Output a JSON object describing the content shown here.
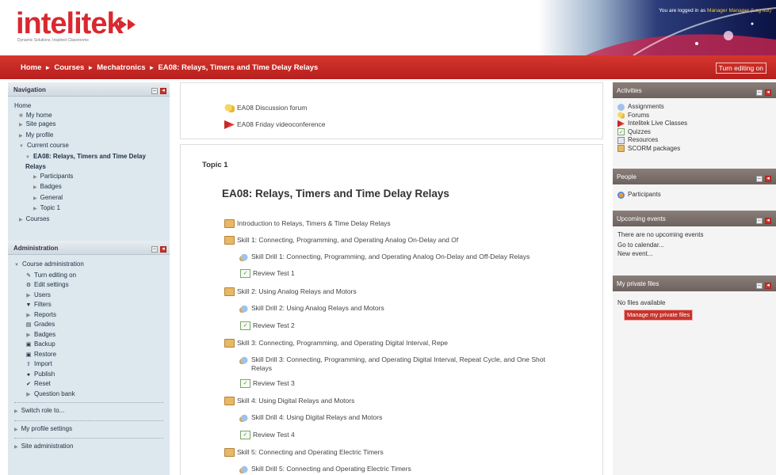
{
  "header": {
    "logo_text": "intelitek",
    "logo_tagline": "Dynamic Solutions, Inspired Classrooms",
    "login_prefix": "You are logged in as",
    "login_user": "Manager Manager",
    "logout": "(Log out)"
  },
  "breadcrumb": {
    "items": [
      "Home",
      "Courses",
      "Mechatronics",
      "EA08: Relays, Timers and Time Delay Relays"
    ],
    "separator": "►",
    "edit_button": "Turn editing on"
  },
  "navigation": {
    "title": "Navigation",
    "home": "Home",
    "my_home": "My home",
    "site_pages": "Site pages",
    "my_profile": "My profile",
    "current_course": "Current course",
    "course": "EA08: Relays, Timers and Time Delay Relays",
    "participants": "Participants",
    "badges": "Badges",
    "general": "General",
    "topic1": "Topic 1",
    "courses": "Courses"
  },
  "administration": {
    "title": "Administration",
    "course_admin": "Course administration",
    "items": [
      "Turn editing on",
      "Edit settings",
      "Users",
      "Filters",
      "Reports",
      "Grades",
      "Badges",
      "Backup",
      "Restore",
      "Import",
      "Publish",
      "Reset",
      "Question bank"
    ],
    "switch_role": "Switch role to...",
    "profile_settings": "My profile settings",
    "site_admin": "Site administration"
  },
  "section0": {
    "forum": "EA08 Discussion forum",
    "video": "EA08 Friday videoconference"
  },
  "section1": {
    "topic": "Topic 1",
    "heading": "EA08: Relays, Timers and Time Delay Relays",
    "items": [
      "Introduction to Relays, Timers & Time Delay Relays",
      "Skill 1: Connecting, Programming, and Operating Analog On-Delay and Of",
      "Skill Drill 1: Connecting, Programming, and Operating Analog On-Delay and Off-Delay Relays",
      "Review Test 1",
      "Skill 2: Using Analog Relays and Motors",
      "Skill Drill 2: Using Analog Relays and Motors",
      "Review Test 2",
      "Skill 3: Connecting, Programming, and Operating Digital Interval, Repe",
      "Skill Drill 3: Connecting, Programming, and Operating Digital Interval, Repeat Cycle, and One Shot Relays",
      "Review Test 3",
      "Skill 4: Using Digital Relays and Motors",
      "Skill Drill 4: Using Digital Relays and Motors",
      "Review Test 4",
      "Skill 5: Connecting and Operating Electric Timers",
      "Skill Drill 5: Connecting and Operating Electric Timers"
    ]
  },
  "activities": {
    "title": "Activities",
    "items": [
      "Assignments",
      "Forums",
      "Intelitek Live Classes",
      "Quizzes",
      "Resources",
      "SCORM packages"
    ]
  },
  "people": {
    "title": "People",
    "participants": "Participants"
  },
  "events": {
    "title": "Upcoming events",
    "none": "There are no upcoming events",
    "calendar": "Go to calendar...",
    "new_event": "New event..."
  },
  "files": {
    "title": "My private files",
    "none": "No files available",
    "manage": "Manage my private files"
  }
}
